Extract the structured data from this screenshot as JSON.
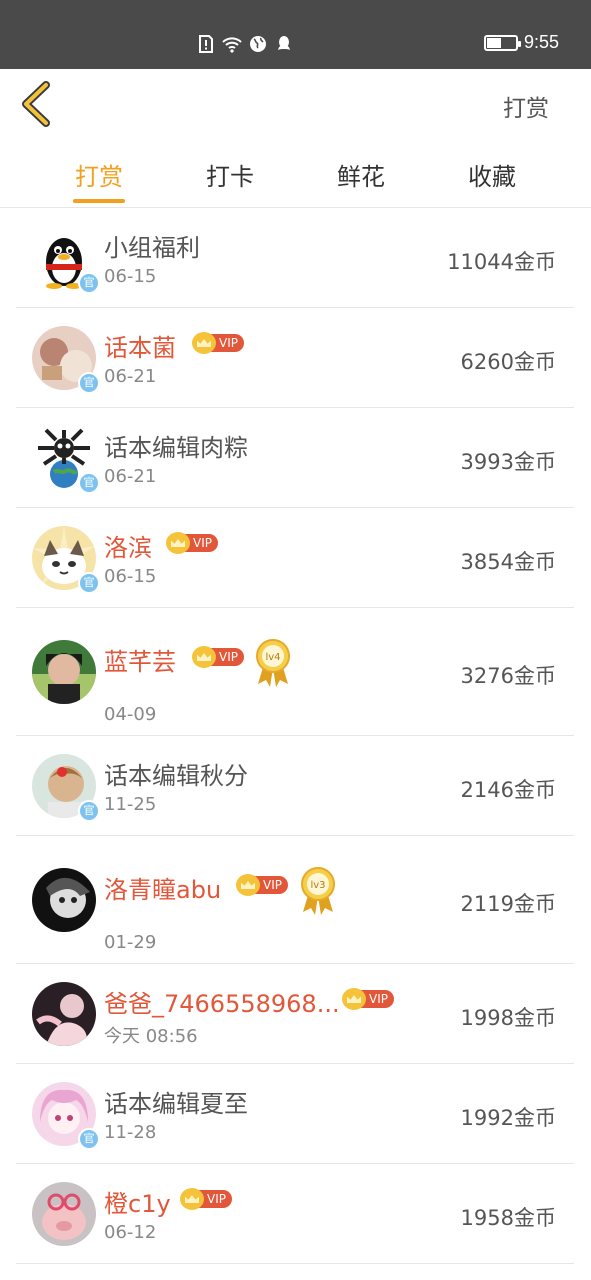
{
  "status_bar": {
    "time": "9:55",
    "battery_level": 0.5,
    "icons": [
      "alert-icon",
      "wifi-icon",
      "globe-icon",
      "qq-icon"
    ]
  },
  "header": {
    "back_icon": "chevron-left-icon",
    "action_label": "打赏"
  },
  "tabs": [
    "打赏",
    "打卡",
    "鲜花",
    "收藏"
  ],
  "active_tab": "打赏",
  "colors": {
    "accent": "#f2a01e",
    "vip_name": "#e2573a",
    "official_badge": "#7ec3ef"
  },
  "official_badge_text": "官",
  "vip_label": "VIP",
  "rows": [
    {
      "name": "小组福利",
      "date": "06-15",
      "coins": "11044金币",
      "vip": false,
      "official": true
    },
    {
      "name": "话本菌",
      "date": "06-21",
      "coins": "6260金币",
      "vip": true,
      "official": true
    },
    {
      "name": "话本编辑肉粽",
      "date": "06-21",
      "coins": "3993金币",
      "vip": false,
      "official": true
    },
    {
      "name": "洛滨",
      "date": "06-15",
      "coins": "3854金币",
      "vip": true,
      "official": true
    },
    {
      "name": "蓝芊芸",
      "date": "04-09",
      "coins": "3276金币",
      "vip": true,
      "official": false,
      "medal": "lv4"
    },
    {
      "name": "话本编辑秋分",
      "date": "11-25",
      "coins": "2146金币",
      "vip": false,
      "official": true
    },
    {
      "name": "洛青瞳abu",
      "date": "01-29",
      "coins": "2119金币",
      "vip": true,
      "official": false,
      "medal": "lv3"
    },
    {
      "name": "爸爸_7466558968...",
      "date": "今天 08:56",
      "coins": "1998金币",
      "vip": true,
      "official": false
    },
    {
      "name": "话本编辑夏至",
      "date": "11-28",
      "coins": "1992金币",
      "vip": false,
      "official": true
    },
    {
      "name": "橙c1y",
      "date": "06-12",
      "coins": "1958金币",
      "vip": true,
      "official": false
    }
  ]
}
